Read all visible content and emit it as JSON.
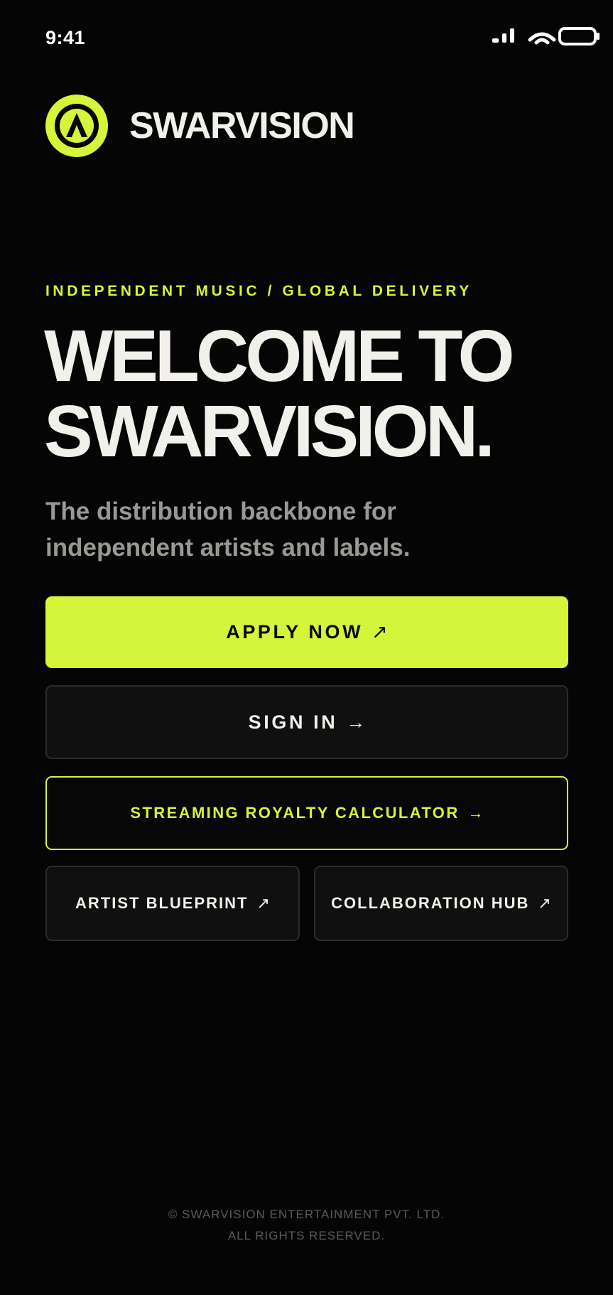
{
  "status_bar": {
    "time": "9:41",
    "icons": [
      "signal-icon",
      "wifi-icon",
      "battery-icon"
    ]
  },
  "brand": {
    "logo_icon": "swarvision-logo-icon",
    "name": "SWARVISION"
  },
  "hero": {
    "eyebrow": "INDEPENDENT MUSIC / GLOBAL DELIVERY",
    "headline_line1": "WELCOME TO",
    "headline_line2": "SWARVISION.",
    "subtitle": "The distribution backbone for independent artists and labels."
  },
  "actions": {
    "apply": {
      "label": "APPLY NOW",
      "arrow": "↗"
    },
    "sign_in": {
      "label": "SIGN IN",
      "arrow": "→"
    },
    "calculator": {
      "label": "STREAMING ROYALTY CALCULATOR",
      "arrow": "→"
    },
    "blueprint": {
      "label": "ARTIST BLUEPRINT",
      "arrow": "↗"
    },
    "collab": {
      "label": "COLLABORATION HUB",
      "arrow": "↗"
    }
  },
  "footer": {
    "line1": "© SWARVISION ENTERTAINMENT PVT. LTD.",
    "line2": "ALL RIGHTS RESERVED."
  },
  "colors": {
    "background": "#050505",
    "accent": "#d4f53a",
    "text_primary": "#f2f0ea",
    "text_muted": "#9a9894",
    "button_dark": "#101010"
  }
}
